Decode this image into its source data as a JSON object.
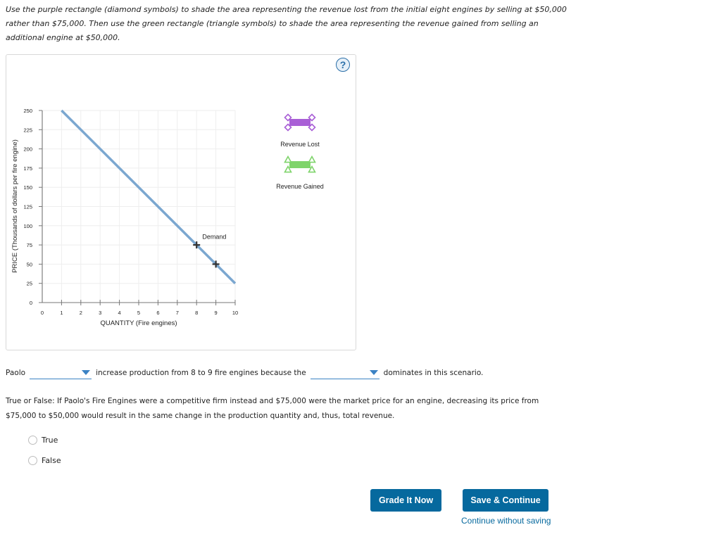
{
  "instructions": "Use the purple rectangle (diamond symbols) to shade the area representing the revenue lost from the initial eight engines by selling at $50,000 rather than $75,000. Then use the green rectangle (triangle symbols) to shade the area representing the revenue gained from selling an additional engine at $50,000.",
  "help": {
    "icon": "question-mark-icon",
    "label": "?"
  },
  "chart_data": {
    "type": "line",
    "title": "",
    "xlabel": "QUANTITY (Fire engines)",
    "ylabel": "PRICE (Thousands of dollars per fire engine)",
    "xlim": [
      0,
      10
    ],
    "ylim": [
      0,
      250
    ],
    "x_ticks": [
      0,
      1,
      2,
      3,
      4,
      5,
      6,
      7,
      8,
      9,
      10
    ],
    "y_ticks": [
      0,
      25,
      50,
      75,
      100,
      125,
      150,
      175,
      200,
      225,
      250
    ],
    "grid": true,
    "series": [
      {
        "name": "Demand",
        "color": "#7ba7d0",
        "points": [
          [
            1,
            250
          ],
          [
            10,
            25
          ]
        ],
        "label": "Demand",
        "label_at": [
          8.3,
          83
        ]
      }
    ],
    "markers": [
      {
        "symbol": "plus",
        "x": 8,
        "y": 75
      },
      {
        "symbol": "plus",
        "x": 9,
        "y": 50
      }
    ],
    "legend": [
      {
        "name": "Revenue Lost",
        "symbol": "diamond",
        "color": "#a95fd6"
      },
      {
        "name": "Revenue Gained",
        "symbol": "triangle",
        "color": "#7fd46b"
      }
    ],
    "legend_position": "right"
  },
  "sentence": {
    "subject": "Paolo",
    "dropdown1_value": "",
    "middle": "increase production from 8 to 9 fire engines because the",
    "dropdown2_value": "",
    "end": "dominates in this scenario."
  },
  "true_false": {
    "question": "True or False: If Paolo's Fire Engines were a competitive firm instead and $75,000 were the market price for an engine, decreasing its price from $75,000 to $50,000 would result in the same change in the production quantity and, thus, total revenue.",
    "options": [
      "True",
      "False"
    ]
  },
  "buttons": {
    "grade": "Grade It Now",
    "save": "Save & Continue",
    "continue_link": "Continue without saving"
  }
}
